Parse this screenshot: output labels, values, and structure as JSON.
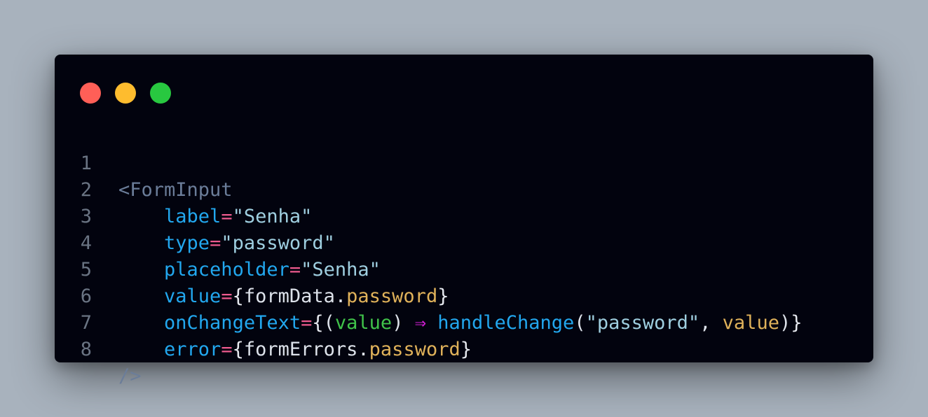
{
  "colors": {
    "background": "#a8b2bd",
    "window": "#02030e",
    "dot_red": "#ff5f57",
    "dot_yellow": "#febc2e",
    "dot_green": "#28c840"
  },
  "window_controls": [
    "close",
    "minimize",
    "maximize"
  ],
  "code": {
    "line_numbers": [
      "1",
      "2",
      "3",
      "4",
      "5",
      "6",
      "7",
      "8"
    ],
    "line1": {
      "open": "<FormInput"
    },
    "line2": {
      "indent": "    ",
      "attr": "label",
      "eq": "=",
      "str": "\"Senha\""
    },
    "line3": {
      "indent": "    ",
      "attr": "type",
      "eq": "=",
      "str": "\"password\""
    },
    "line4": {
      "indent": "    ",
      "attr": "placeholder",
      "eq": "=",
      "str": "\"Senha\""
    },
    "line5": {
      "indent": "    ",
      "attr": "value",
      "eq": "=",
      "lbrace": "{",
      "obj": "formData",
      "dot": ".",
      "prop": "password",
      "rbrace": "}"
    },
    "line6": {
      "indent": "    ",
      "attr": "onChangeText",
      "eq": "=",
      "lbrace": "{",
      "lparen": "(",
      "param": "value",
      "rparen": ")",
      "sp1": " ",
      "arrow": "⇒",
      "sp2": " ",
      "fn": "handleChange",
      "call_open": "(",
      "arg1": "\"password\"",
      "comma": ", ",
      "arg2": "value",
      "call_close": ")",
      "rbrace": "}"
    },
    "line7": {
      "indent": "    ",
      "attr": "error",
      "eq": "=",
      "lbrace": "{",
      "obj": "formErrors",
      "dot": ".",
      "prop": "password",
      "rbrace": "}"
    },
    "line8": {
      "close": "/>"
    }
  }
}
